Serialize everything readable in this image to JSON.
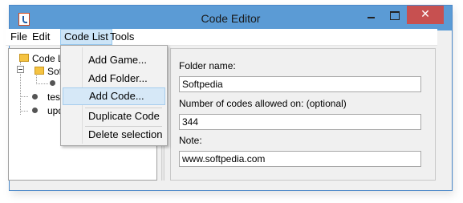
{
  "window": {
    "title": "Code Editor",
    "close_glyph": "✕"
  },
  "menubar": {
    "items": [
      {
        "label": "File"
      },
      {
        "label": "Edit"
      },
      {
        "label": "Code List"
      },
      {
        "label": "Tools"
      }
    ]
  },
  "tree": {
    "root": "Code List",
    "folder": "Softpedia",
    "items": [
      "test",
      "update"
    ]
  },
  "dropdown": {
    "items": [
      {
        "label": "Add Game..."
      },
      {
        "label": "Add Folder..."
      },
      {
        "label": "Add Code..."
      },
      {
        "label": "Duplicate Code"
      },
      {
        "label": "Delete selection"
      }
    ]
  },
  "form": {
    "folder_name_label": "Folder name:",
    "folder_name_value": "Softpedia",
    "codes_allowed_label": "Number of codes allowed on: (optional)",
    "codes_allowed_value": "344",
    "note_label": "Note:",
    "note_value": "www.softpedia.com"
  },
  "colors": {
    "titlebar": "#5b9bd5",
    "close": "#c75050",
    "highlight": "#d6e8f7"
  }
}
